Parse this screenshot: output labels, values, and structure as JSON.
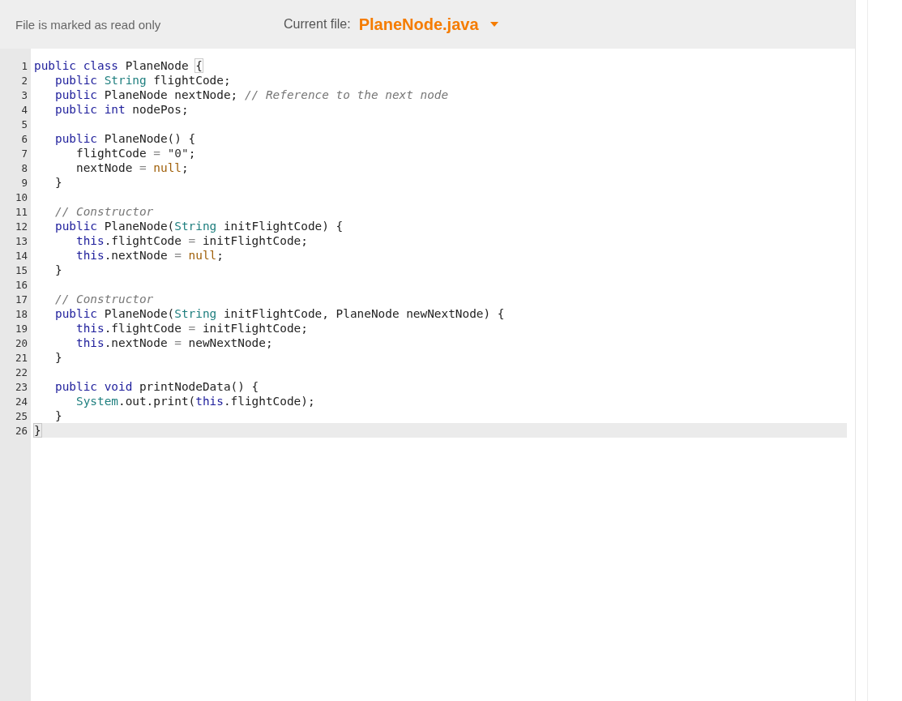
{
  "header": {
    "status": "File is marked as read only",
    "file_label": "Current file:",
    "file_name": "PlaneNode.java"
  },
  "lines": [
    {
      "number": "1",
      "active": false,
      "tokens": [
        {
          "kind": "keyword",
          "text": "public class"
        },
        {
          "kind": "plain",
          "text": " PlaneNode "
        },
        {
          "kind": "bracket",
          "text": "{"
        }
      ]
    },
    {
      "number": "2",
      "active": false,
      "tokens": [
        {
          "kind": "keyword",
          "text": "   public "
        },
        {
          "kind": "type",
          "text": "String"
        },
        {
          "kind": "plain",
          "text": " flightCode;"
        }
      ]
    },
    {
      "number": "3",
      "active": false,
      "tokens": [
        {
          "kind": "keyword",
          "text": "   public"
        },
        {
          "kind": "plain",
          "text": " PlaneNode nextNode; "
        },
        {
          "kind": "comment",
          "text": "// Reference to the next node"
        }
      ]
    },
    {
      "number": "4",
      "active": false,
      "tokens": [
        {
          "kind": "keyword",
          "text": "   public int"
        },
        {
          "kind": "plain",
          "text": " nodePos;"
        }
      ]
    },
    {
      "number": "5",
      "active": false
    },
    {
      "number": "6",
      "active": false,
      "tokens": [
        {
          "kind": "keyword",
          "text": "   public"
        },
        {
          "kind": "plain",
          "text": " PlaneNode() {"
        }
      ]
    },
    {
      "number": "7",
      "active": false,
      "tokens": [
        {
          "kind": "plain",
          "text": "      flightCode "
        },
        {
          "kind": "operator",
          "text": "="
        },
        {
          "kind": "string",
          "text": " \"0\""
        },
        {
          "kind": "plain",
          "text": ";"
        }
      ]
    },
    {
      "number": "8",
      "active": false,
      "tokens": [
        {
          "kind": "plain",
          "text": "      nextNode "
        },
        {
          "kind": "operator",
          "text": "="
        },
        {
          "kind": "atom",
          "text": " null"
        },
        {
          "kind": "plain",
          "text": ";"
        }
      ]
    },
    {
      "number": "9",
      "active": false,
      "tokens": [
        {
          "kind": "plain",
          "text": "   }"
        }
      ]
    },
    {
      "number": "10",
      "active": false
    },
    {
      "number": "11",
      "active": false,
      "tokens": [
        {
          "kind": "comment",
          "text": "   // Constructor"
        }
      ]
    },
    {
      "number": "12",
      "active": false,
      "tokens": [
        {
          "kind": "keyword",
          "text": "   public"
        },
        {
          "kind": "plain",
          "text": " PlaneNode("
        },
        {
          "kind": "type",
          "text": "String"
        },
        {
          "kind": "plain",
          "text": " initFlightCode) {"
        }
      ]
    },
    {
      "number": "13",
      "active": false,
      "tokens": [
        {
          "kind": "keyword",
          "text": "      this"
        },
        {
          "kind": "plain",
          "text": ".flightCode "
        },
        {
          "kind": "operator",
          "text": "="
        },
        {
          "kind": "plain",
          "text": " initFlightCode;"
        }
      ]
    },
    {
      "number": "14",
      "active": false,
      "tokens": [
        {
          "kind": "keyword",
          "text": "      this"
        },
        {
          "kind": "plain",
          "text": ".nextNode "
        },
        {
          "kind": "operator",
          "text": "="
        },
        {
          "kind": "atom",
          "text": " null"
        },
        {
          "kind": "plain",
          "text": ";"
        }
      ]
    },
    {
      "number": "15",
      "active": false,
      "tokens": [
        {
          "kind": "plain",
          "text": "   }"
        }
      ]
    },
    {
      "number": "16",
      "active": false
    },
    {
      "number": "17",
      "active": false,
      "tokens": [
        {
          "kind": "comment",
          "text": "   // Constructor"
        }
      ]
    },
    {
      "number": "18",
      "active": false,
      "tokens": [
        {
          "kind": "keyword",
          "text": "   public"
        },
        {
          "kind": "plain",
          "text": " PlaneNode("
        },
        {
          "kind": "type",
          "text": "String"
        },
        {
          "kind": "plain",
          "text": " initFlightCode, PlaneNode newNextNode) {"
        }
      ]
    },
    {
      "number": "19",
      "active": false,
      "tokens": [
        {
          "kind": "keyword",
          "text": "      this"
        },
        {
          "kind": "plain",
          "text": ".flightCode "
        },
        {
          "kind": "operator",
          "text": "="
        },
        {
          "kind": "plain",
          "text": " initFlightCode;"
        }
      ]
    },
    {
      "number": "20",
      "active": false,
      "tokens": [
        {
          "kind": "keyword",
          "text": "      this"
        },
        {
          "kind": "plain",
          "text": ".nextNode "
        },
        {
          "kind": "operator",
          "text": "="
        },
        {
          "kind": "plain",
          "text": " newNextNode;"
        }
      ]
    },
    {
      "number": "21",
      "active": false,
      "tokens": [
        {
          "kind": "plain",
          "text": "   }"
        }
      ]
    },
    {
      "number": "22",
      "active": false
    },
    {
      "number": "23",
      "active": false,
      "tokens": [
        {
          "kind": "keyword",
          "text": "   public void"
        },
        {
          "kind": "plain",
          "text": " printNodeData() {"
        }
      ]
    },
    {
      "number": "24",
      "active": false,
      "tokens": [
        {
          "kind": "type",
          "text": "      System"
        },
        {
          "kind": "plain",
          "text": ".out.print("
        },
        {
          "kind": "keyword",
          "text": "this"
        },
        {
          "kind": "plain",
          "text": ".flightCode);"
        }
      ]
    },
    {
      "number": "25",
      "active": false,
      "tokens": [
        {
          "kind": "plain",
          "text": "   }"
        }
      ]
    },
    {
      "number": "26",
      "active": true,
      "tokens": [
        {
          "kind": "bracket",
          "text": "}"
        }
      ]
    }
  ]
}
